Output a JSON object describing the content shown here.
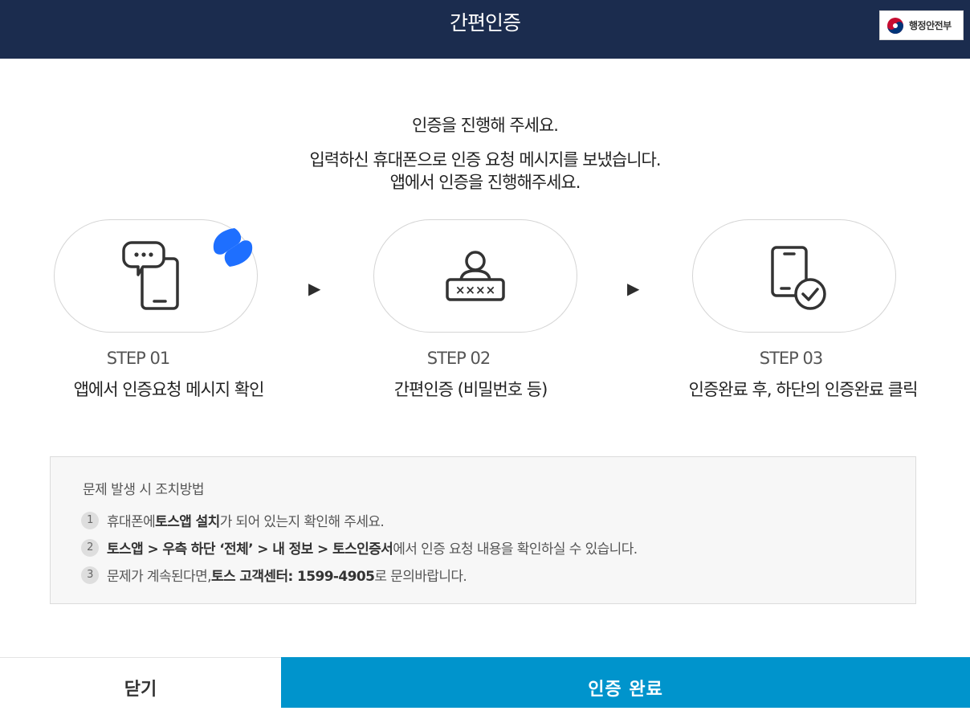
{
  "header": {
    "title": "간편인증",
    "gov_logo_text": "행정안전부"
  },
  "message": {
    "line1": "인증을 진행해 주세요.",
    "line2": "입력하신 휴대폰으로 인증 요청 메시지를 보냈습니다.",
    "line3": "앱에서 인증을 진행해주세요."
  },
  "steps": [
    {
      "number": "STEP 01",
      "description": "앱에서 인증요청 메시지 확인",
      "icon": "phone-message-icon"
    },
    {
      "number": "STEP 02",
      "description": "간편인증 (비밀번호 등)",
      "icon": "user-password-icon"
    },
    {
      "number": "STEP 03",
      "description": "인증완료 후, 하단의 인증완료 클릭",
      "icon": "phone-check-icon"
    }
  ],
  "trouble": {
    "title": "문제 발생 시 조치방법",
    "items": [
      {
        "num": "1",
        "pre": "휴대폰에 ",
        "bold": "토스앱 설치",
        "post": "가 되어 있는지 확인해 주세요."
      },
      {
        "num": "2",
        "pre": "",
        "bold": "토스앱 > 우측 하단 ‘전체’ > 내 정보 > 토스인증서",
        "post": "에서 인증 요청 내용을 확인하실 수 있습니다."
      },
      {
        "num": "3",
        "pre": "문제가 계속된다면, ",
        "bold": "토스 고객센터: 1599-4905",
        "post": "로 문의바랍니다."
      }
    ]
  },
  "buttons": {
    "close": "닫기",
    "done": "인증 완료"
  },
  "colors": {
    "header_bg": "#1b2c4e",
    "done_button": "#0094cc",
    "toss_brand": "#1e6fff"
  }
}
